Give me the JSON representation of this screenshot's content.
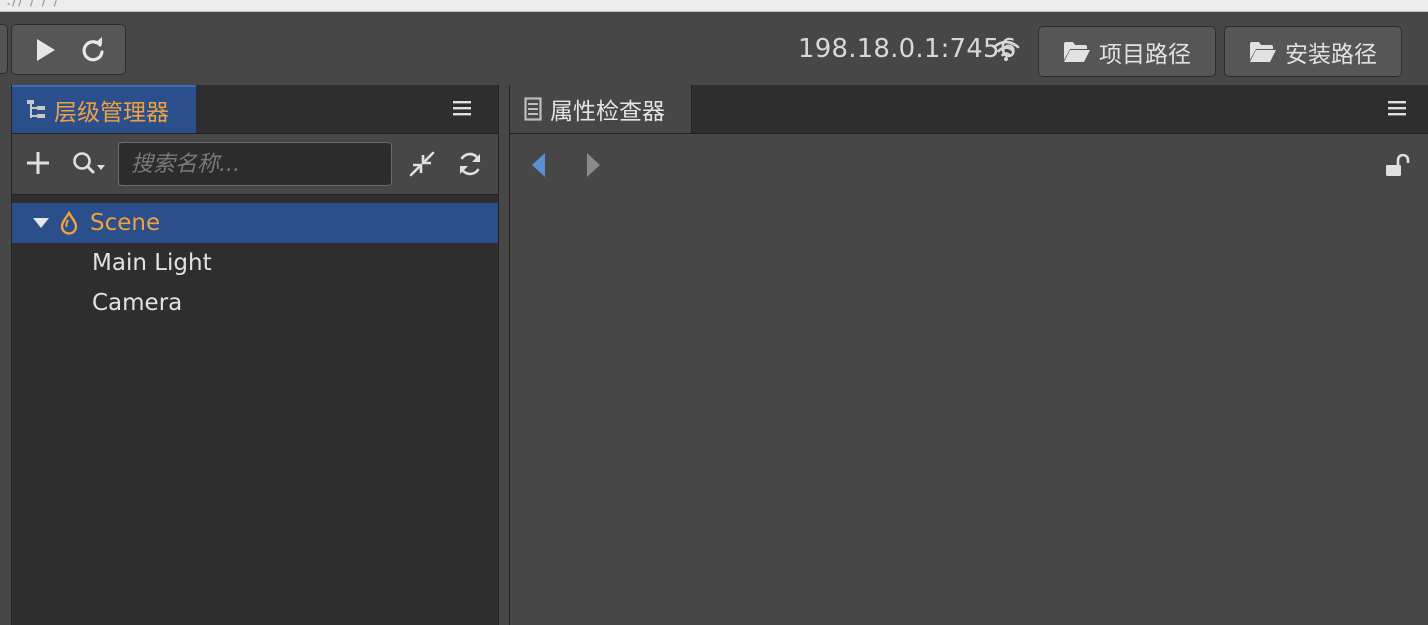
{
  "top_strip": {
    "text": "://  /  /  /"
  },
  "toolbar": {
    "ip_text": "198.18.0.1:7456",
    "project_path_label": "项目路径",
    "install_path_label": "安装路径"
  },
  "hierarchy": {
    "tab_label": "层级管理器",
    "search_placeholder": "搜索名称...",
    "tree": {
      "root": "Scene",
      "children": [
        "Main Light",
        "Camera"
      ]
    }
  },
  "inspector": {
    "tab_label": "属性检查器"
  },
  "colors": {
    "accent_orange": "#f0a040",
    "selection_blue": "#2b4f8a",
    "nav_back_blue": "#5a8fd6",
    "panel_dark": "#2e2e2e",
    "panel_mid": "#474747"
  },
  "icons": {
    "play": "play-icon",
    "reload": "reload-icon",
    "wifi": "wifi-icon",
    "folder": "folder-open-icon",
    "hierarchy": "hierarchy-icon",
    "menu": "hamburger-menu-icon",
    "add": "plus-icon",
    "search": "search-dropdown-icon",
    "collapse": "collapse-icon",
    "refresh": "refresh-icon",
    "scene": "scene-drop-icon",
    "inspector": "inspector-icon",
    "back": "arrow-left-icon",
    "forward": "arrow-right-icon",
    "lock": "unlock-icon"
  }
}
